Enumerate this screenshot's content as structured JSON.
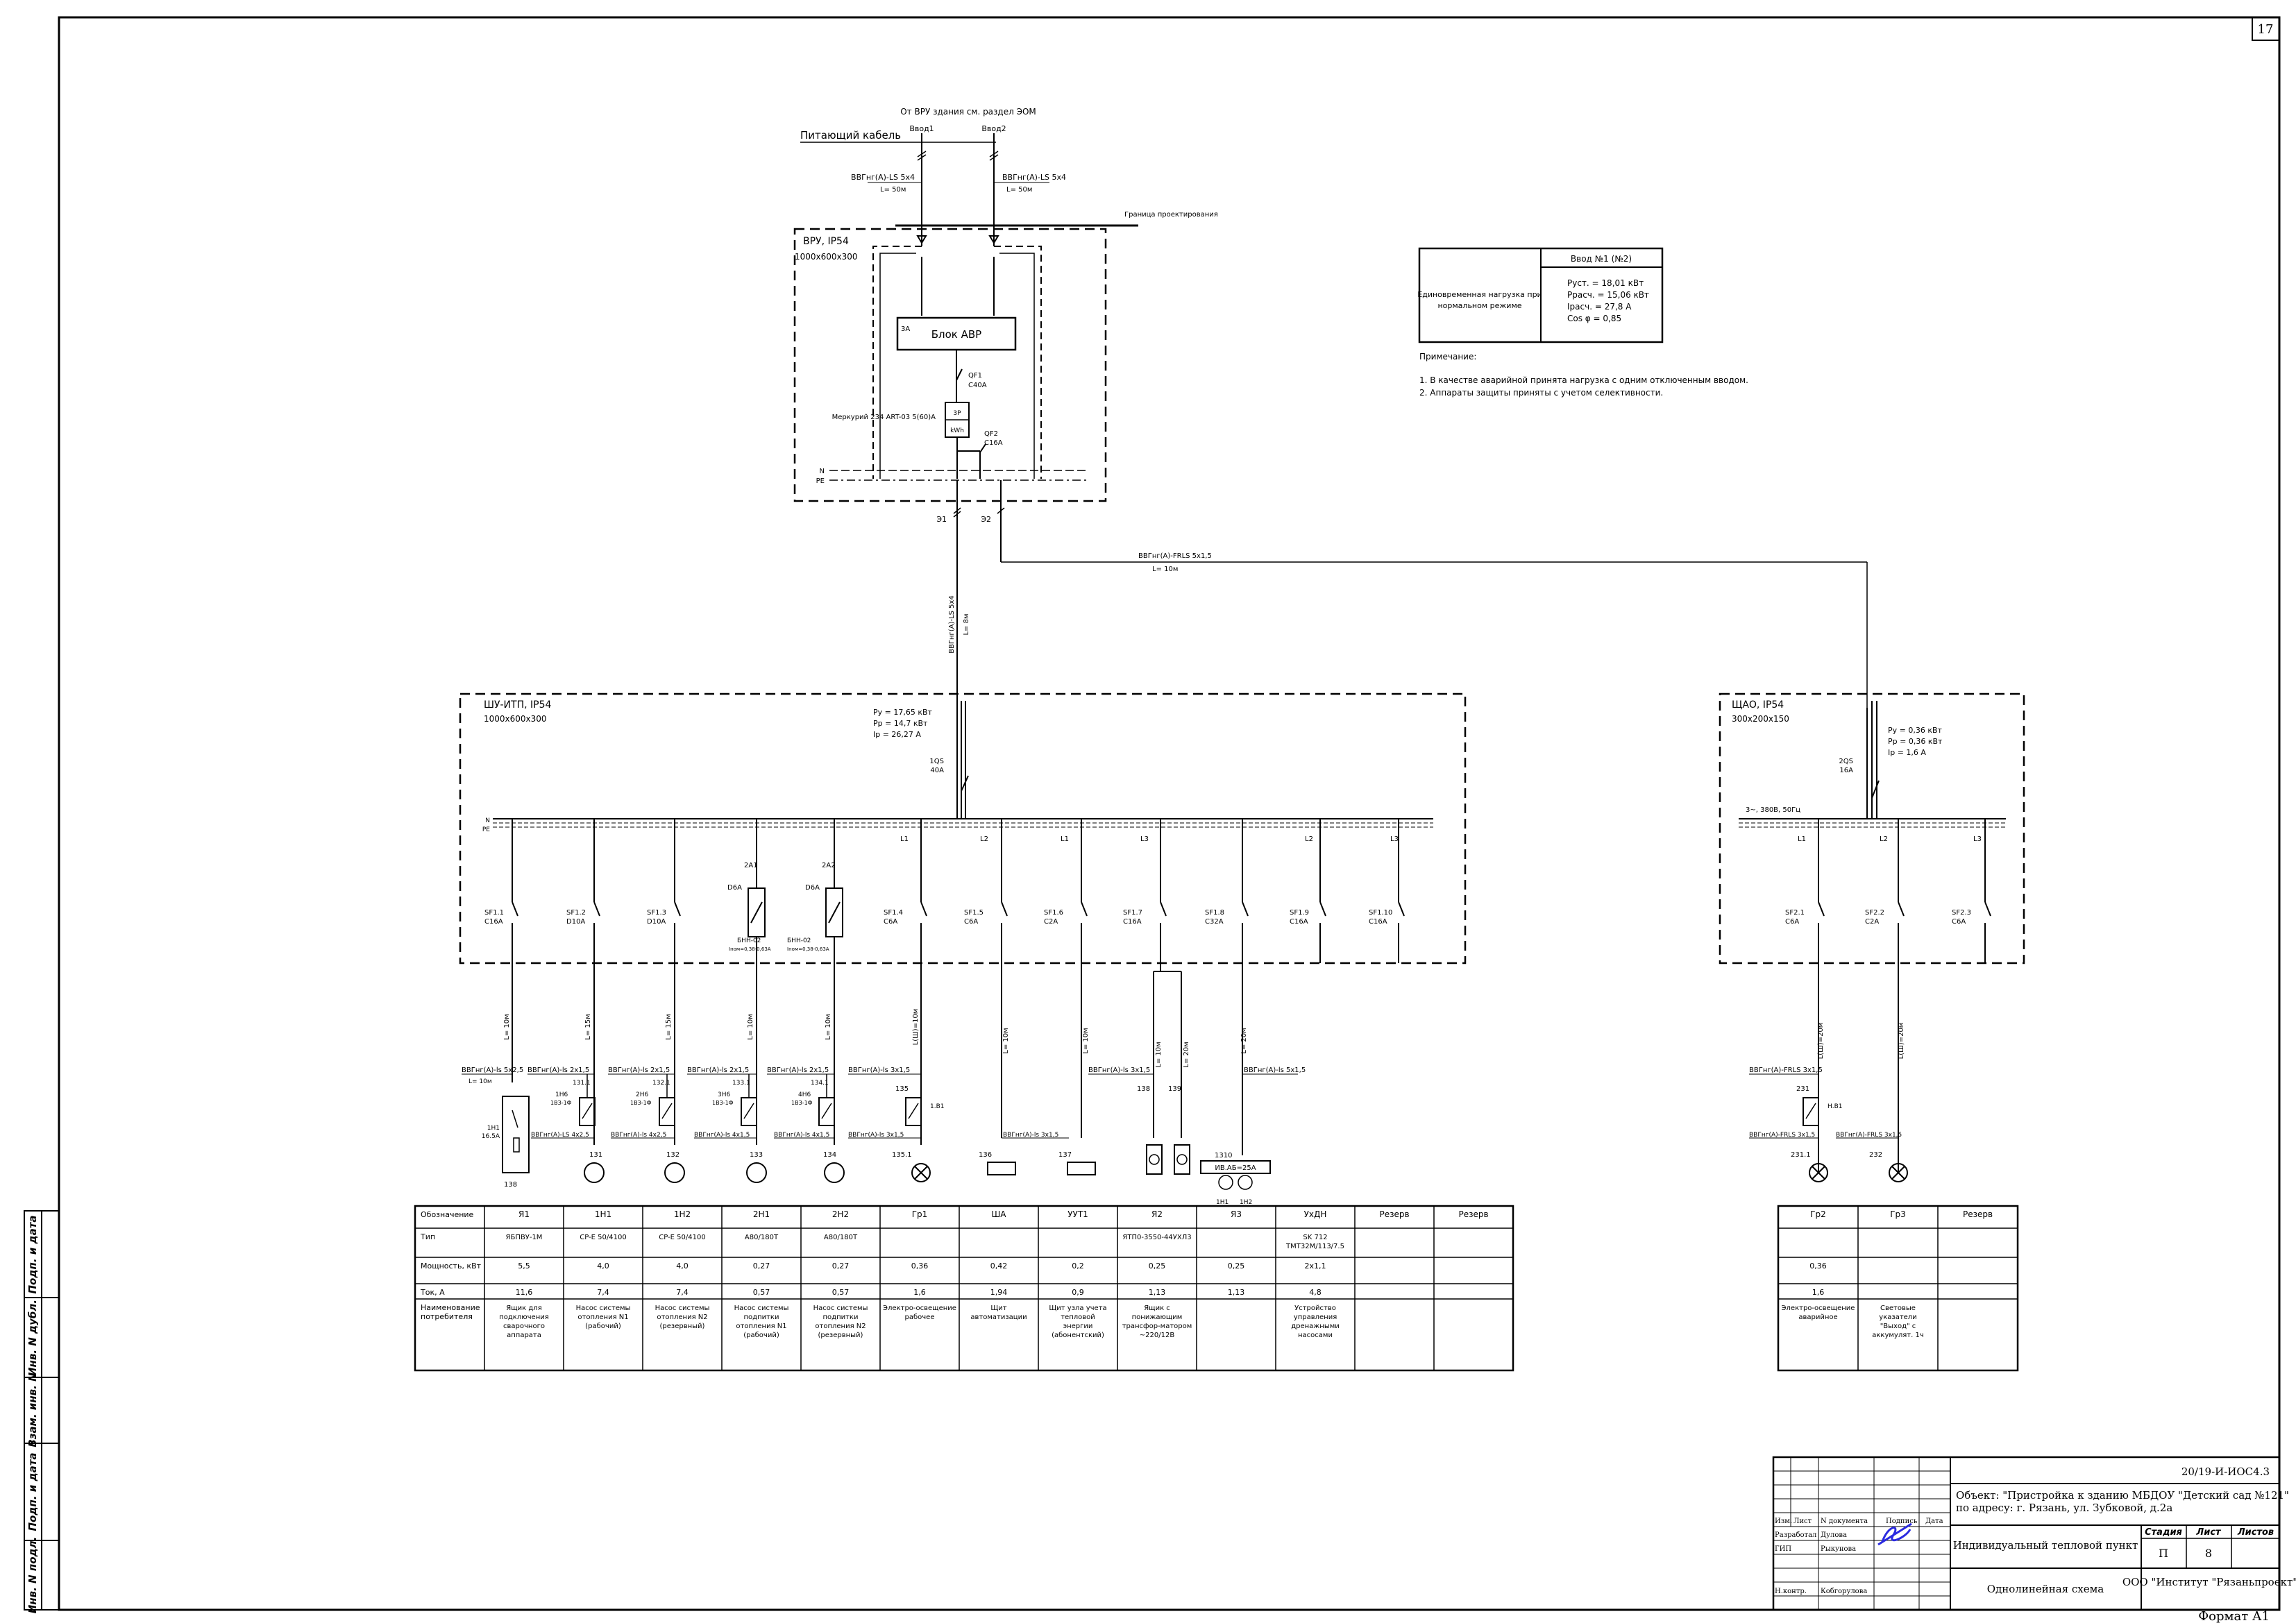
{
  "sheet_number": "17",
  "format": "Формат А1",
  "top": {
    "source": "От ВРУ здания см. раздел ЭОМ",
    "feeder_label": "Питающий кабель",
    "input1": "Ввод1",
    "input2": "Ввод2",
    "cable1": "ВВГнг(А)-LS 5х4",
    "cable2": "ВВГнг(А)-LS 5х4",
    "len1": "L= 50м",
    "len2": "L= 50м",
    "boundary": "Граница проектирования"
  },
  "vru": {
    "title": "ВРУ, IP54",
    "size": "1000х600х300",
    "avr": "Блок АВР",
    "avr_tag": "3А",
    "qf1": "QF1",
    "qf1_rating": "С40А",
    "meter": "Меркурий 234 ART-03 5(60)А",
    "meter_tag": "3Р",
    "kwh": "kWh",
    "qf2": "QF2",
    "qf2_rating": "С16А",
    "n": "N",
    "pe": "PE",
    "out1": "Э1",
    "out2": "Э2"
  },
  "cable_e2": {
    "type": "ВВГнг(А)-FRLS 5х1,5",
    "len": "L= 10м"
  },
  "cable_e1": {
    "type": "ВВГнг(А)-LS 5х4",
    "len": "L= 8м"
  },
  "load_table": {
    "header": "Ввод №1 (№2)",
    "label": "Единовременная нагрузка при нормальном режиме",
    "values": [
      "Руст. = 18,01 кВт",
      "Ррасч. = 15,06 кВт",
      "Iрасч. = 27,8 А",
      "Cos φ = 0,85"
    ]
  },
  "notes": {
    "title": "Примечание:",
    "items": [
      "1. В качестве аварийной принята нагрузка с одним отключенным вводом.",
      "2. Аппараты защиты приняты с учетом селективности."
    ]
  },
  "shu": {
    "title": "ШУ-ИТП, IP54",
    "size": "1000х600х300",
    "params": [
      "Ру = 17,65 кВт",
      "Рр = 14,7 кВт",
      "Iр = 26,27 А"
    ],
    "main": "1QS",
    "main_rating": "40А",
    "n": "N",
    "pe": "PE",
    "phases": [
      "L1",
      "L2",
      "L1",
      "L3",
      "L2",
      "L3"
    ],
    "breakers": [
      {
        "name": "SF1.1",
        "rating": "С16А"
      },
      {
        "name": "SF1.2",
        "rating": "D10A"
      },
      {
        "name": "SF1.3",
        "rating": "D10A"
      },
      {
        "name": "SF1.4",
        "rating": "С6А"
      },
      {
        "name": "SF1.5",
        "rating": "С6А"
      },
      {
        "name": "SF1.6",
        "rating": "С2А"
      },
      {
        "name": "SF1.7",
        "rating": "С16А"
      },
      {
        "name": "SF1.8",
        "rating": "С32А"
      },
      {
        "name": "SF1.9",
        "rating": "С16А"
      },
      {
        "name": "SF1.10",
        "rating": "С16А"
      }
    ],
    "aux1": {
      "name": "2А1",
      "rating": "D6A",
      "relay": "БНН-02",
      "relay_sub": "Iном=0,38-0,63А"
    },
    "aux2": {
      "name": "2А2",
      "rating": "D6A",
      "relay": "БНН-02",
      "relay_sub": "Iном=0,38-0,63А"
    }
  },
  "shao": {
    "title": "ЩАО, IP54",
    "size": "300х200х150",
    "params": [
      "Ру = 0,36 кВт",
      "Рр = 0,36 кВт",
      "Iр = 1,6 А"
    ],
    "main": "2QS",
    "main_rating": "16А",
    "supply": "3~, 380В, 50Гц",
    "phases": [
      "L1",
      "L2",
      "L3"
    ],
    "breakers": [
      {
        "name": "SF2.1",
        "rating": "С6А"
      },
      {
        "name": "SF2.2",
        "rating": "С2А"
      },
      {
        "name": "SF2.3",
        "rating": "С6А"
      }
    ]
  },
  "feeders": [
    {
      "vlen": "L= 10м",
      "c1": "ВВГнг(А)-ls 5х2,5",
      "c1len": "L= 10м",
      "tag": "1Н1",
      "tag_sub": "1Б1",
      "c2": "ВВГнг(А)-ls 4х2,5",
      "end": "138",
      "box": "1Н1",
      "box_rating": "16.5А"
    },
    {
      "vlen": "L= 15м",
      "c1": "ВВГнг(А)-ls 2х1,5",
      "tag": "131.1",
      "tag2": "1Н6",
      "tag3": "1ВЗ-1Ф",
      "c2": "ВВГнг(А)-LS 4х2,5",
      "end": "131"
    },
    {
      "vlen": "L= 15м",
      "c1": "ВВГнг(А)-ls 2х1,5",
      "tag": "132.1",
      "tag2": "2Н6",
      "tag3": "1ВЗ-1Ф",
      "c2": "ВВГнг(А)-ls 4х2,5",
      "end": "132"
    },
    {
      "vlen": "L= 10м",
      "c1": "ВВГнг(А)-ls 2х1,5",
      "tag": "133.1",
      "tag2": "3Н6",
      "tag3": "1ВЗ-1Ф",
      "c2": "ВВГнг(А)-ls 4х1,5",
      "end": "133"
    },
    {
      "vlen": "L= 10м",
      "c1": "ВВГнг(А)-ls 2х1,5",
      "tag": "134.1",
      "tag2": "4Н6",
      "tag3": "1ВЗ-1Ф",
      "c2": "ВВГнг(А)-ls 4х1,5",
      "end": "134"
    },
    {
      "vlen": "L(Ш)=10м",
      "c1": "ВВГнг(А)-ls 3х1,5",
      "tag": "135",
      "tag2": "1.В1",
      "c2": "ВВГнг(А)-ls 3х1,5",
      "end": "135.1"
    },
    {
      "vlen": "L= 10м",
      "c2": "ВВГнг(А)-ls 3х1,5",
      "end": "136"
    },
    {
      "vlen": "L= 10м",
      "c2": "ВВГнг(А)-ls 3х1,5",
      "end": "137"
    },
    {
      "vlen": "L= 10м",
      "c1": "ВВГнг(А)-ls 3х1,5",
      "tag": "138",
      "vlen2": "L= 20м",
      "tag2": "139",
      "end": "1310"
    },
    {
      "vlen": "L= 20м",
      "c1": "ВВГнг(А)-ls 5х1,5",
      "end": "1310",
      "pump_label": "ИВ.АБ=25А",
      "pumps": [
        "1Н1",
        "1Н2"
      ]
    }
  ],
  "shao_feeders": [
    {
      "vlen": "L(Ш)=20м",
      "c1": "ВВГнг(А)-FRLS 3х1,5",
      "tag": "231",
      "tag2": "Н.В1",
      "c2": "ВВГнг(А)-FRLS 3х1,5",
      "end": "231.1"
    },
    {
      "vlen": "L(Ш)=20м",
      "c2": "ВВГнг(А)-FRLS 3х1,5",
      "end": "232"
    }
  ],
  "main_table": {
    "row_labels": [
      "Обозначение",
      "Тип",
      "Мощность, кВт",
      "Ток, А",
      "Наименование потребителя"
    ],
    "cols": [
      {
        "id": "Я1",
        "type": "ЯБПВУ-1М",
        "p": "5,5",
        "i": "11,6",
        "name": "Ящик для подключения сварочного аппарата"
      },
      {
        "id": "1Н1",
        "type": "CP-E 50/4100",
        "p": "4,0",
        "i": "7,4",
        "name": "Насос системы отопления N1 (рабочий)"
      },
      {
        "id": "1Н2",
        "type": "CP-E 50/4100",
        "p": "4,0",
        "i": "7,4",
        "name": "Насос системы отопления N2 (резервный)"
      },
      {
        "id": "2Н1",
        "type": "A80/180T",
        "p": "0,27",
        "i": "0,57",
        "name": "Насос системы подпитки отопления N1 (рабочий)"
      },
      {
        "id": "2Н2",
        "type": "A80/180T",
        "p": "0,27",
        "i": "0,57",
        "name": "Насос системы подпитки отопления N2 (резервный)"
      },
      {
        "id": "Гр1",
        "type": "",
        "p": "0,36",
        "i": "1,6",
        "name": "Электро-освещение рабочее"
      },
      {
        "id": "ША",
        "type": "",
        "p": "0,42",
        "i": "1,94",
        "name": "Щит автоматизации"
      },
      {
        "id": "УУТ1",
        "type": "",
        "p": "0,2",
        "i": "0,9",
        "name": "Щит узла учета тепловой энергии (абонентский)"
      },
      {
        "id": "Я2",
        "type": "ЯТП0-3550-44УХЛ3",
        "p": "0,25",
        "i": "1,13",
        "name": "Ящик с понижающим трансфор-матором ~220/12В"
      },
      {
        "id": "Я3",
        "type": "",
        "p": "0,25",
        "i": "1,13",
        "name": ""
      },
      {
        "id": "УхДН",
        "type": "SK 712 TMT32M/113/7.5",
        "p": "2х1,1",
        "i": "4,8",
        "name": "Устройство управления дренажными насосами"
      },
      {
        "id": "Резерв",
        "type": "",
        "p": "",
        "i": "",
        "name": ""
      },
      {
        "id": "Резерв",
        "type": "",
        "p": "",
        "i": "",
        "name": ""
      }
    ]
  },
  "shao_table": {
    "cols": [
      {
        "id": "Гр2",
        "p": "0,36",
        "i": "1,6",
        "name": "Электро-освещение аварийное"
      },
      {
        "id": "Гр3",
        "p": "",
        "i": "",
        "name": "Световые указатели \"Выход\" с аккумулят. 1ч"
      },
      {
        "id": "Резерв",
        "p": "",
        "i": "",
        "name": ""
      }
    ]
  },
  "side_stamp": [
    "Подп. и дата",
    "Инв. N дубл.",
    "Взам. инв. N",
    "Подп. и дата",
    "Инв. N подл."
  ],
  "title_block": {
    "code": "20/19-И-ИОС4.3",
    "object_line1": "Объект: \"Пристройка к зданию МБДОУ \"Детский сад №121\"",
    "object_line2": "по адресу: г. Рязань, ул. Зубковой, д.2а",
    "headers": [
      "Изм.",
      "Лист",
      "N документа",
      "Подпись",
      "Дата"
    ],
    "roles": [
      {
        "role": "Разработал",
        "name": "Дулова"
      },
      {
        "role": "ГИП",
        "name": "Рыкунова"
      },
      {
        "role": "Н.контр.",
        "name": "Кобгорулова"
      }
    ],
    "subject": "Индивидуальный тепловой пункт",
    "sheet_title": "Однолинейная схема",
    "stage_header": "Стадия",
    "sheet_header": "Лист",
    "sheets_header": "Листов",
    "stage": "П",
    "sheet": "8",
    "sheets": "",
    "org": "ООО \"Институт \"Рязаньпроект\""
  }
}
